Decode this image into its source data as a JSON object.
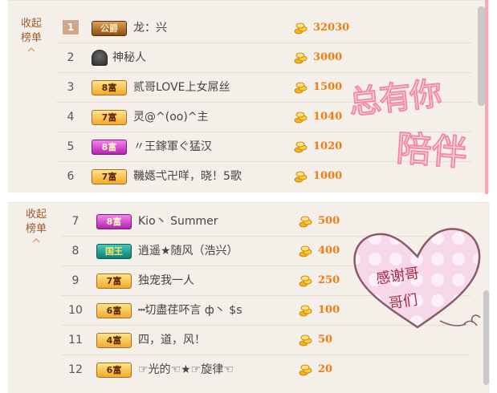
{
  "collapse_label": "收起榜单",
  "panel_top": {
    "rows": [
      {
        "rank": "1",
        "badge": "公爵",
        "badge_style": "duke",
        "name": "龙：兴",
        "amount": "32030"
      },
      {
        "rank": "2",
        "badge": "",
        "badge_style": "mystery",
        "name": "神秘人",
        "amount": "3000"
      },
      {
        "rank": "3",
        "badge": "8富",
        "badge_style": "gold",
        "name": "贰哥LOVE上女屌丝",
        "amount": "1500"
      },
      {
        "rank": "4",
        "badge": "7富",
        "badge_style": "gold",
        "name": "灵@^(oo)^主",
        "amount": "1040"
      },
      {
        "rank": "5",
        "badge": "8富",
        "badge_style": "purple",
        "name": "〃王鎵軍ぐ猛汉",
        "amount": "1020"
      },
      {
        "rank": "6",
        "badge": "7富",
        "badge_style": "gold",
        "name": "鞿嫕弌卍咩，晓！5歌",
        "amount": "1000"
      }
    ]
  },
  "panel_bottom": {
    "rows": [
      {
        "rank": "7",
        "badge": "8富",
        "badge_style": "purple",
        "name": "Kio丶 Summer",
        "amount": "500"
      },
      {
        "rank": "8",
        "badge": "国王",
        "badge_style": "king",
        "name": "逍遥★随风（浩兴）",
        "amount": "400"
      },
      {
        "rank": "9",
        "badge": "7富",
        "badge_style": "gold",
        "name": "独宠我一人",
        "amount": "250"
      },
      {
        "rank": "10",
        "badge": "6富",
        "badge_style": "gold",
        "name": "┅切盡荏吥言 ф丶 $s",
        "amount": "100"
      },
      {
        "rank": "11",
        "badge": "4富",
        "badge_style": "gold",
        "name": "四，道，风！",
        "amount": "50"
      },
      {
        "rank": "12",
        "badge": "6富",
        "badge_style": "gold",
        "name": "☞光的☜★☞旋律☜",
        "amount": "20"
      }
    ]
  },
  "decor": {
    "top_right_text_1": "总有你",
    "top_right_text_2": "陪伴",
    "heart_text_1": "感谢哥",
    "heart_text_2": "哥们"
  },
  "colors": {
    "amount": "#ee7d12",
    "panel_bg": "#f4efe8",
    "collapse": "#a35b2e",
    "pink": "#f08aa8"
  }
}
